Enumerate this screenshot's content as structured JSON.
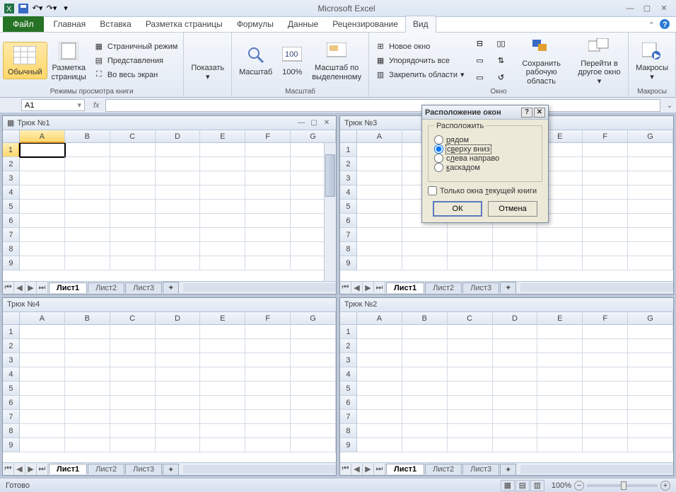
{
  "app_title": "Microsoft Excel",
  "qat_icons": [
    "excel-icon",
    "save-icon",
    "undo-icon",
    "redo-icon"
  ],
  "ribbon_tabs": {
    "file": "Файл",
    "items": [
      "Главная",
      "Вставка",
      "Разметка страницы",
      "Формулы",
      "Данные",
      "Рецензирование",
      "Вид"
    ],
    "active_index": 6
  },
  "ribbon": {
    "groups": {
      "views": {
        "label": "Режимы просмотра книги",
        "normal": "Обычный",
        "page_layout": "Разметка\nстраницы",
        "page_break": "Страничный режим",
        "custom_views": "Представления",
        "full_screen": "Во весь экран"
      },
      "show": {
        "label": "Показать"
      },
      "zoom": {
        "label": "Масштаб",
        "zoom": "Масштаб",
        "hundred": "100%",
        "to_selection": "Масштаб по\nвыделенному"
      },
      "window": {
        "label": "Окно",
        "new_window": "Новое окно",
        "arrange_all": "Упорядочить все",
        "freeze": "Закрепить области",
        "save_workspace": "Сохранить\nрабочую область",
        "switch_windows": "Перейти в\nдругое окно"
      },
      "macros": {
        "label": "Макросы",
        "macros": "Макросы"
      }
    }
  },
  "formula_bar": {
    "cell_ref": "A1",
    "fx": "fx",
    "value": ""
  },
  "workbooks": [
    {
      "title": "Трюк №1",
      "active": true,
      "rows": 9,
      "cols": [
        "A",
        "B",
        "C",
        "D",
        "E",
        "F",
        "G"
      ],
      "sheets": [
        "Лист1",
        "Лист2",
        "Лист3"
      ]
    },
    {
      "title": "Трюк №3",
      "active": false,
      "rows": 9,
      "cols": [
        "A",
        "B",
        "C",
        "D",
        "E",
        "F",
        "G"
      ],
      "sheets": [
        "Лист1",
        "Лист2",
        "Лист3"
      ]
    },
    {
      "title": "Трюк №4",
      "active": false,
      "rows": 9,
      "cols": [
        "A",
        "B",
        "C",
        "D",
        "E",
        "F",
        "G"
      ],
      "sheets": [
        "Лист1",
        "Лист2",
        "Лист3"
      ]
    },
    {
      "title": "Трюк №2",
      "active": false,
      "rows": 9,
      "cols": [
        "A",
        "B",
        "C",
        "D",
        "E",
        "F",
        "G"
      ],
      "sheets": [
        "Лист1",
        "Лист2",
        "Лист3"
      ]
    }
  ],
  "dialog": {
    "title": "Расположение окон",
    "group_label": "Расположить",
    "options": [
      {
        "label_pre": "",
        "accel": "р",
        "label_post": "ядом",
        "selected": false
      },
      {
        "label_pre": "с",
        "accel": "в",
        "label_post": "ерху вниз",
        "selected": true
      },
      {
        "label_pre": "с",
        "accel": "л",
        "label_post": "ева направо",
        "selected": false
      },
      {
        "label_pre": "",
        "accel": "к",
        "label_post": "аскадом",
        "selected": false
      }
    ],
    "checkbox_pre": "Только окна ",
    "checkbox_accel": "т",
    "checkbox_post": "екущей книги",
    "ok": "ОК",
    "cancel": "Отмена"
  },
  "status": {
    "ready": "Готово",
    "zoom": "100%"
  }
}
